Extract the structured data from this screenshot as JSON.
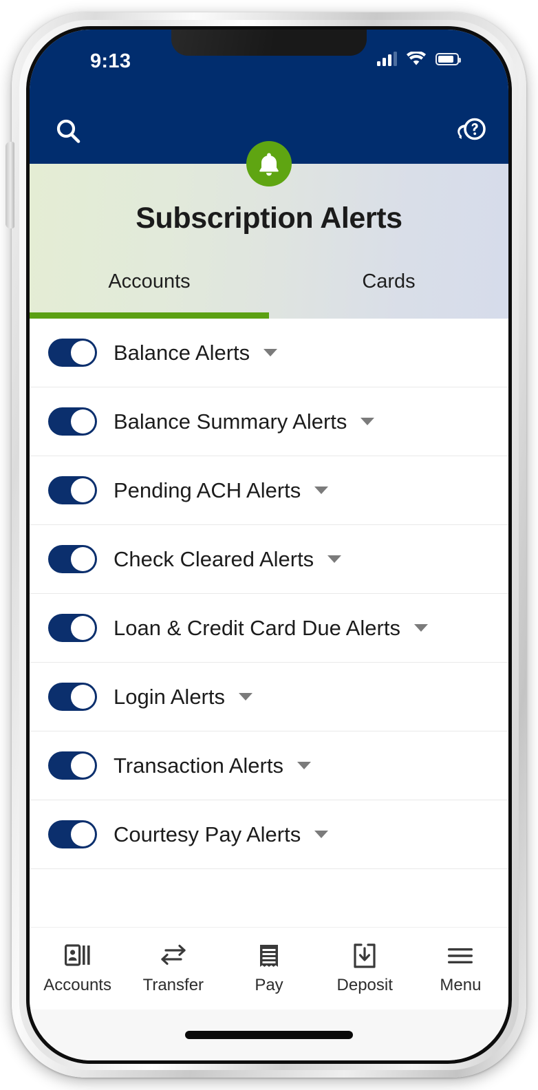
{
  "status_bar": {
    "time": "9:13",
    "signal_icon": "cellular-signal-icon",
    "wifi_icon": "wifi-icon",
    "battery_icon": "battery-icon"
  },
  "nav": {
    "search_icon": "search-icon",
    "help_icon": "help-chat-icon",
    "bell_icon": "bell-icon"
  },
  "header": {
    "title": "Subscription Alerts",
    "gradient_start": "#e4edd4",
    "gradient_end": "#d6dceb",
    "accent_green": "#5ba013",
    "brand_navy": "#012d6e"
  },
  "tabs": [
    {
      "label": "Accounts",
      "active": true
    },
    {
      "label": "Cards",
      "active": false
    }
  ],
  "alerts": [
    {
      "label": "Balance Alerts",
      "enabled": true
    },
    {
      "label": "Balance Summary Alerts",
      "enabled": true
    },
    {
      "label": "Pending ACH Alerts",
      "enabled": true
    },
    {
      "label": "Check Cleared Alerts",
      "enabled": true
    },
    {
      "label": "Loan & Credit Card Due Alerts",
      "enabled": true
    },
    {
      "label": "Login Alerts",
      "enabled": true
    },
    {
      "label": "Transaction Alerts",
      "enabled": true
    },
    {
      "label": "Courtesy Pay Alerts",
      "enabled": true
    }
  ],
  "bottom_nav": [
    {
      "label": "Accounts",
      "icon": "contact-card-icon"
    },
    {
      "label": "Transfer",
      "icon": "transfer-arrows-icon"
    },
    {
      "label": "Pay",
      "icon": "receipt-icon"
    },
    {
      "label": "Deposit",
      "icon": "deposit-download-icon"
    },
    {
      "label": "Menu",
      "icon": "hamburger-menu-icon"
    }
  ]
}
